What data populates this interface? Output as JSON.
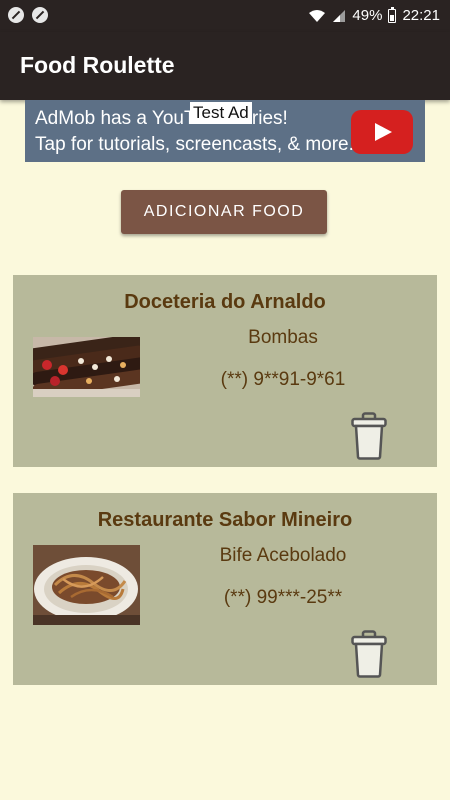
{
  "status_bar": {
    "battery": "49%",
    "time": "22:21"
  },
  "app_bar": {
    "title": "Food Roulette"
  },
  "ad": {
    "line1": "AdMob has a YouTube series!",
    "line2": "Tap for tutorials, screencasts, & more.",
    "tag": "Test Ad"
  },
  "add_button_label": "ADICIONAR FOOD",
  "foods": [
    {
      "name": "Doceteria do Arnaldo",
      "dish": "Bombas",
      "phone": "(**) 9**91-9*61"
    },
    {
      "name": "Restaurante Sabor Mineiro",
      "dish": "Bife Acebolado",
      "phone": "(**) 99***-25**"
    }
  ],
  "colors": {
    "app_bar": "#2a2322",
    "background": "#fbf9dc",
    "card": "#b7b99a",
    "button": "#7b5545",
    "text_brown": "#5a3a10"
  }
}
